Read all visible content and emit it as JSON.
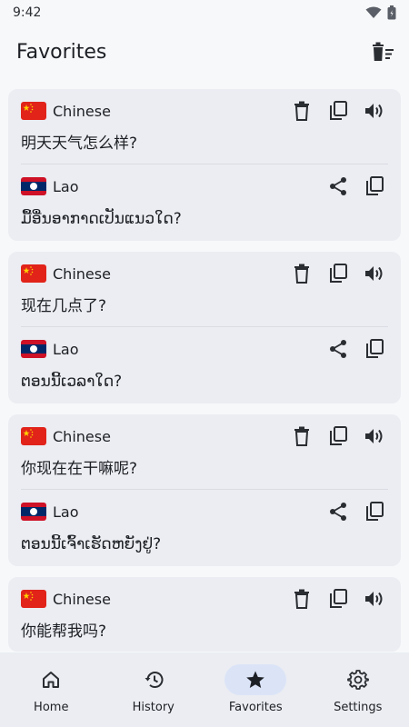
{
  "status_bar": {
    "time": "9:42",
    "icons": [
      "wifi-icon",
      "battery-icon"
    ]
  },
  "app_bar": {
    "title": "Favorites",
    "action_icon": "delete-all-icon"
  },
  "favorites": [
    {
      "source": {
        "language": "Chinese",
        "flag": "china-flag",
        "text": "明天天气怎么样?"
      },
      "target": {
        "language": "Lao",
        "flag": "laos-flag",
        "text": "ມື້ອື່ນອາກາດເປັນແນວໃດ?"
      }
    },
    {
      "source": {
        "language": "Chinese",
        "flag": "china-flag",
        "text": "现在几点了?"
      },
      "target": {
        "language": "Lao",
        "flag": "laos-flag",
        "text": "ຕອນນີ້ເວລາໃດ?"
      }
    },
    {
      "source": {
        "language": "Chinese",
        "flag": "china-flag",
        "text": "你现在在干嘛呢?"
      },
      "target": {
        "language": "Lao",
        "flag": "laos-flag",
        "text": "ຕອນນີ້ເຈົ້າເຮັດຫຍັງຢູ່?"
      }
    },
    {
      "source": {
        "language": "Chinese",
        "flag": "china-flag",
        "text": "你能帮我吗?"
      }
    }
  ],
  "bottom_nav": {
    "items": [
      {
        "label": "Home",
        "icon": "home-icon"
      },
      {
        "label": "History",
        "icon": "history-icon"
      },
      {
        "label": "Favorites",
        "icon": "star-icon",
        "active": true
      },
      {
        "label": "Settings",
        "icon": "gear-icon"
      }
    ]
  },
  "colors": {
    "background": "#f7f8fa",
    "card": "#ebedf2",
    "active_pill": "#dbe4f7",
    "text": "#1c1f24"
  }
}
